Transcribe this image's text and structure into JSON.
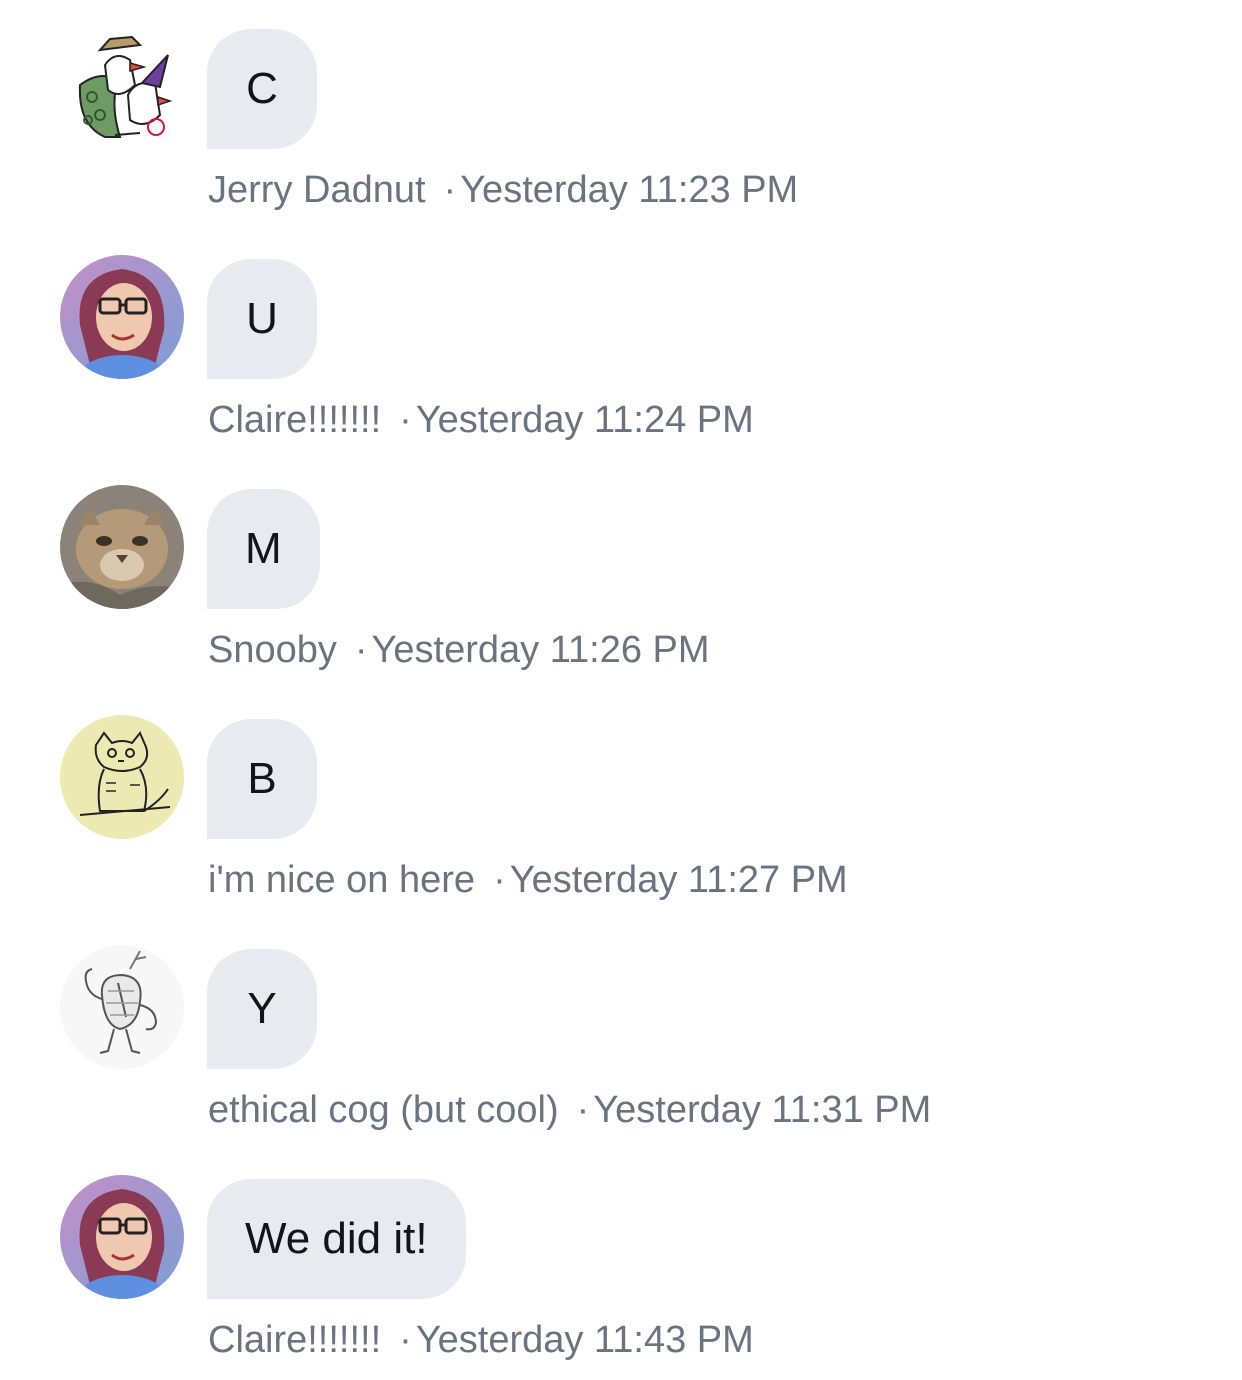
{
  "messages": [
    {
      "avatar_icon": "birds-cartoon-avatar",
      "text": "C",
      "author": "Jerry Dadnut",
      "separator": "·",
      "time": "Yesterday 11:23 PM"
    },
    {
      "avatar_icon": "woman-glasses-photo-avatar",
      "text": "U",
      "author": "Claire!!!!!!!",
      "separator": "·",
      "time": "Yesterday 11:24 PM"
    },
    {
      "avatar_icon": "cougar-photo-avatar",
      "text": "M",
      "author": "Snooby",
      "separator": "·",
      "time": "Yesterday 11:26 PM"
    },
    {
      "avatar_icon": "cat-drawing-avatar",
      "text": "B",
      "author": "i'm nice on here",
      "separator": "·",
      "time": "Yesterday 11:27 PM"
    },
    {
      "avatar_icon": "steak-character-avatar",
      "text": "Y",
      "author": "ethical cog (but cool)",
      "separator": "·",
      "time": "Yesterday 11:31 PM"
    },
    {
      "avatar_icon": "woman-glasses-photo-avatar",
      "text": "We did it!",
      "author": "Claire!!!!!!!",
      "separator": "·",
      "time": "Yesterday 11:43 PM"
    }
  ],
  "colors": {
    "bubble_bg": "#e8eaef",
    "bubble_text": "#111418",
    "meta_text": "#6b7380",
    "background": "#ffffff"
  }
}
